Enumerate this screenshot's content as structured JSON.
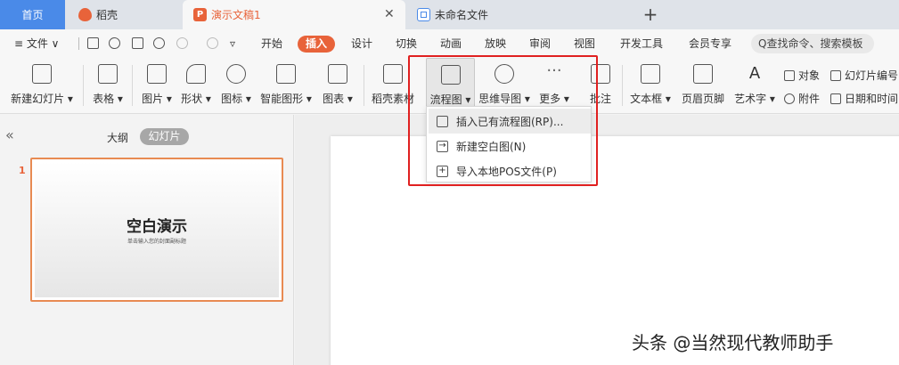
{
  "tabs": {
    "home": "首页",
    "daoke": "稻壳",
    "active_doc": "演示文稿1",
    "unnamed": "未命名文件",
    "add": "+",
    "close": "✕"
  },
  "menu": {
    "file": "≡ 文件 ∨",
    "items": [
      "开始",
      "插入",
      "设计",
      "切换",
      "动画",
      "放映",
      "审阅",
      "视图",
      "开发工具",
      "会员专享"
    ],
    "search": "Q查找命令、搜索模板"
  },
  "ribbon": {
    "new_slide": "新建幻灯片 ▾",
    "table": "表格 ▾",
    "picture": "图片 ▾",
    "shape": "形状 ▾",
    "icon": "图标 ▾",
    "smartart": "智能图形 ▾",
    "chart": "图表 ▾",
    "daoke_material": "稻壳素材",
    "flowchart": "流程图 ▾",
    "mindmap": "思维导图 ▾",
    "more": "更多 ▾",
    "comment": "批注",
    "textbox": "文本框 ▾",
    "header_footer": "页眉页脚",
    "wordart": "艺术字 ▾",
    "object": "对象",
    "slide_number": "幻灯片编号",
    "attachment": "附件",
    "datetime": "日期和时间"
  },
  "flow_menu": {
    "items": [
      "插入已有流程图(RP)...",
      "新建空白图(N)",
      "导入本地POS文件(P)"
    ]
  },
  "left_panel": {
    "collapse": "«",
    "outline_tab": "大纲",
    "slides_tab": "幻灯片",
    "slide_number": "1",
    "thumb_title": "空白演示",
    "thumb_subtitle": "单击输入您的封面副标题"
  },
  "watermark": "头条 @当然现代教师助手",
  "colors": {
    "accent": "#e8633a",
    "home_tab": "#4a8ae8",
    "highlight_frame": "#e02020"
  }
}
